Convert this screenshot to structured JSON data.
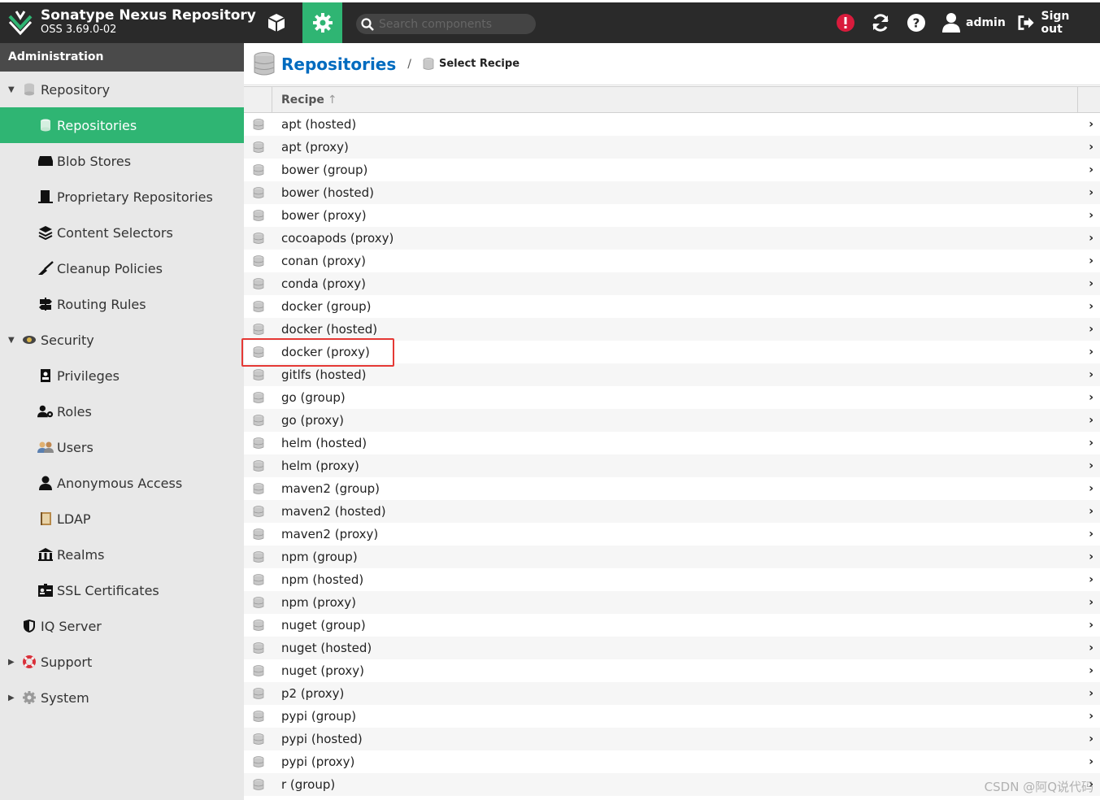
{
  "header": {
    "title": "Sonatype Nexus Repository",
    "version": "OSS 3.69.0-02",
    "search_placeholder": "Search components",
    "user": "admin",
    "signout": "Sign out"
  },
  "sidebar": {
    "heading": "Administration",
    "items": [
      {
        "label": "Repository",
        "level": 1,
        "expanded": true,
        "icon": "database-icon"
      },
      {
        "label": "Repositories",
        "level": 2,
        "active": true,
        "icon": "database-icon"
      },
      {
        "label": "Blob Stores",
        "level": 2,
        "icon": "drive-icon"
      },
      {
        "label": "Proprietary Repositories",
        "level": 2,
        "icon": "proprietary-icon"
      },
      {
        "label": "Content Selectors",
        "level": 2,
        "icon": "layers-icon"
      },
      {
        "label": "Cleanup Policies",
        "level": 2,
        "icon": "broom-icon"
      },
      {
        "label": "Routing Rules",
        "level": 2,
        "icon": "signpost-icon"
      },
      {
        "label": "Security",
        "level": 1,
        "expanded": true,
        "icon": "eye-icon"
      },
      {
        "label": "Privileges",
        "level": 2,
        "icon": "id-badge-icon"
      },
      {
        "label": "Roles",
        "level": 2,
        "icon": "users-gear-icon"
      },
      {
        "label": "Users",
        "level": 2,
        "icon": "users-icon"
      },
      {
        "label": "Anonymous Access",
        "level": 2,
        "icon": "user-icon"
      },
      {
        "label": "LDAP",
        "level": 2,
        "icon": "book-icon"
      },
      {
        "label": "Realms",
        "level": 2,
        "icon": "realms-icon"
      },
      {
        "label": "SSL Certificates",
        "level": 2,
        "icon": "certificate-icon"
      },
      {
        "label": "IQ Server",
        "level": 1,
        "icon": "shield-icon"
      },
      {
        "label": "Support",
        "level": 1,
        "collapsed": true,
        "icon": "lifebuoy-icon"
      },
      {
        "label": "System",
        "level": 1,
        "collapsed": true,
        "icon": "gear-icon"
      }
    ]
  },
  "breadcrumb": {
    "title": "Repositories",
    "separator": "/",
    "current": "Select Recipe"
  },
  "grid": {
    "column": "Recipe",
    "sort_indicator": "↑",
    "rows": [
      "apt (hosted)",
      "apt (proxy)",
      "bower (group)",
      "bower (hosted)",
      "bower (proxy)",
      "cocoapods (proxy)",
      "conan (proxy)",
      "conda (proxy)",
      "docker (group)",
      "docker (hosted)",
      "docker (proxy)",
      "gitlfs (hosted)",
      "go (group)",
      "go (proxy)",
      "helm (hosted)",
      "helm (proxy)",
      "maven2 (group)",
      "maven2 (hosted)",
      "maven2 (proxy)",
      "npm (group)",
      "npm (hosted)",
      "npm (proxy)",
      "nuget (group)",
      "nuget (hosted)",
      "nuget (proxy)",
      "p2 (proxy)",
      "pypi (group)",
      "pypi (hosted)",
      "pypi (proxy)",
      "r (group)"
    ],
    "highlighted_row": "docker (proxy)"
  },
  "watermark": "CSDN @阿Q说代码",
  "colors": {
    "accent": "#2fb573",
    "link": "#006bbf",
    "header": "#2a2a2a",
    "highlight": "#e53935"
  }
}
